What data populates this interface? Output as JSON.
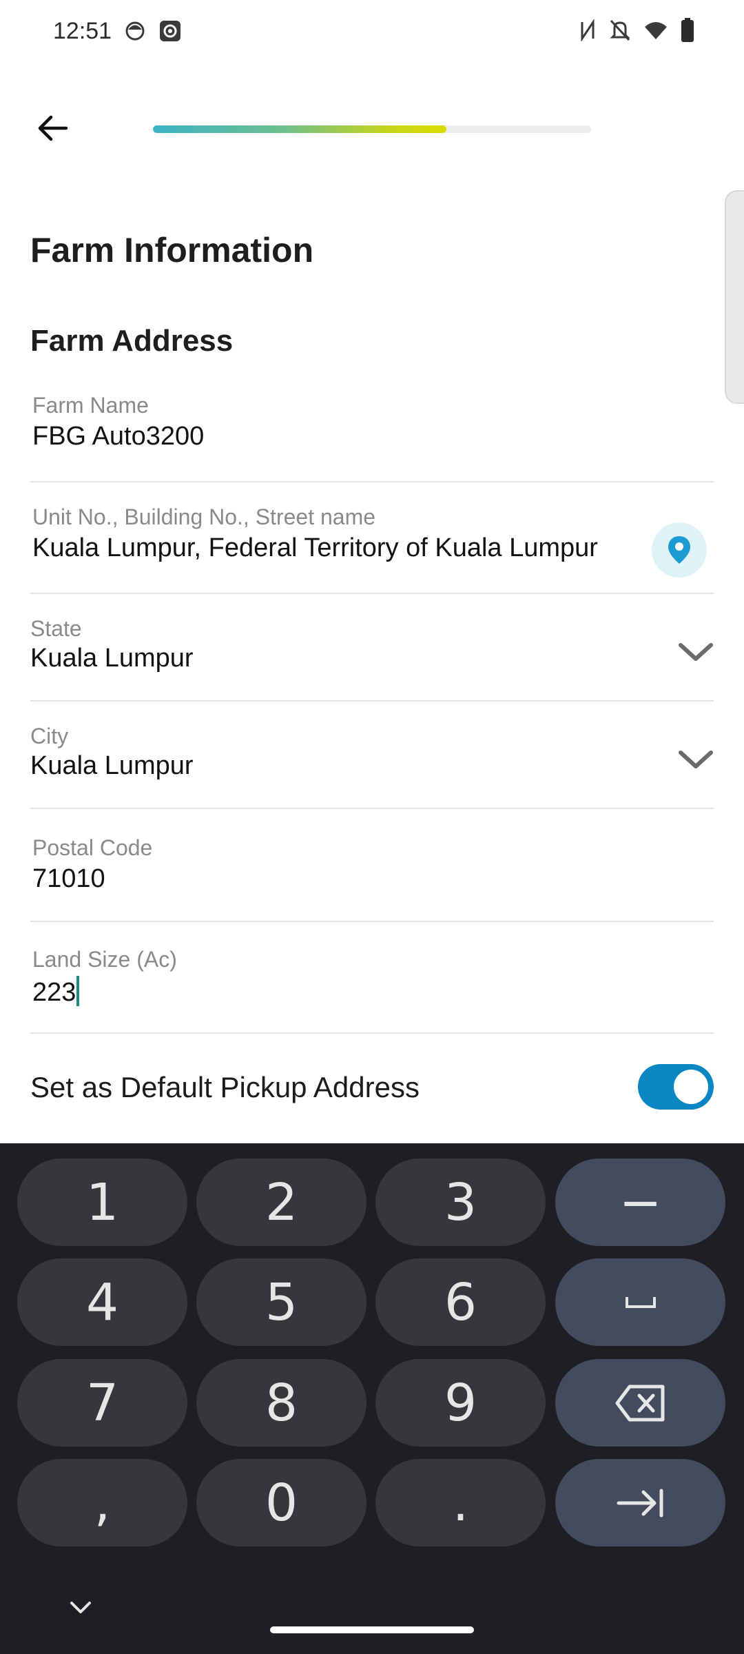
{
  "status_bar": {
    "time": "12:51",
    "left_icons": [
      "face-icon",
      "camera-icon"
    ],
    "right_icons": [
      "nfc-icon",
      "notifications-off-icon",
      "wifi-icon",
      "battery-icon"
    ]
  },
  "top_bar": {
    "back_icon": "arrow-left-icon",
    "progress_fraction": 0.67
  },
  "page": {
    "title": "Farm Information",
    "section_title": "Farm Address"
  },
  "form": {
    "farm_name": {
      "label": "Farm Name",
      "value": "FBG Auto3200"
    },
    "street": {
      "label": "Unit No., Building No., Street name",
      "value": " Kuala Lumpur, Federal Territory of Kuala Lumpur"
    },
    "state": {
      "label": "State",
      "value": "Kuala Lumpur"
    },
    "city": {
      "label": "City",
      "value": "Kuala Lumpur"
    },
    "postal_code": {
      "label": "Postal Code",
      "value": "71010"
    },
    "land_size": {
      "label": "Land Size (Ac)",
      "value": "223"
    },
    "default_pickup": {
      "label": "Set as Default Pickup Address",
      "on": true
    }
  },
  "colors": {
    "accent": "#0a86c2",
    "progress_start": "#3cb3c6",
    "progress_end": "#d9de00",
    "keyboard_bg": "#1f1f23"
  },
  "keyboard": {
    "keys": [
      {
        "label": "1"
      },
      {
        "label": "2"
      },
      {
        "label": "3"
      },
      {
        "label": "−"
      },
      {
        "label": "4"
      },
      {
        "label": "5"
      },
      {
        "label": "6"
      },
      {
        "label": "space",
        "icon": "space-icon"
      },
      {
        "label": "7"
      },
      {
        "label": "8"
      },
      {
        "label": "9"
      },
      {
        "label": "backspace",
        "icon": "backspace-icon"
      },
      {
        "label": ","
      },
      {
        "label": "0"
      },
      {
        "label": "."
      },
      {
        "label": "next",
        "icon": "tab-next-icon"
      }
    ]
  }
}
